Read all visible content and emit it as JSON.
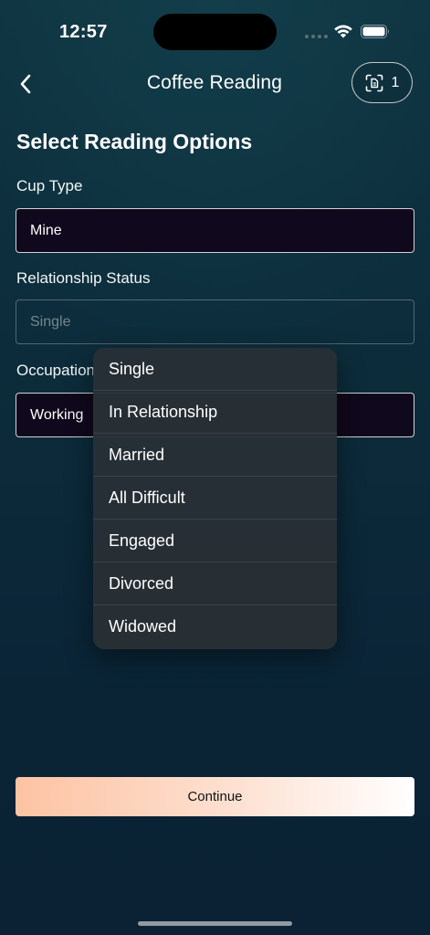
{
  "status_bar": {
    "time": "12:57",
    "icons": [
      "signal-dots-icon",
      "wifi-icon",
      "battery-icon"
    ]
  },
  "header": {
    "back_icon": "chevron-left-icon",
    "title": "Coffee Reading",
    "scan_button": {
      "icon": "scan-document-icon",
      "count": "1"
    }
  },
  "form": {
    "section_title": "Select Reading Options",
    "cup_type": {
      "label": "Cup Type",
      "value": "Mine"
    },
    "relationship_status": {
      "label": "Relationship Status",
      "placeholder": "Single"
    },
    "occupation": {
      "label": "Occupation",
      "value": "Working"
    }
  },
  "dropdown": {
    "options": [
      "Single",
      "In Relationship",
      "Married",
      "All Difficult",
      "Engaged",
      "Divorced",
      "Widowed"
    ]
  },
  "continue_label": "Continue",
  "colors": {
    "background": "#0c2b3a",
    "field_fill": "#10081c",
    "button_gradient_start": "#fdc3a3",
    "button_gradient_end": "#ffffff"
  }
}
